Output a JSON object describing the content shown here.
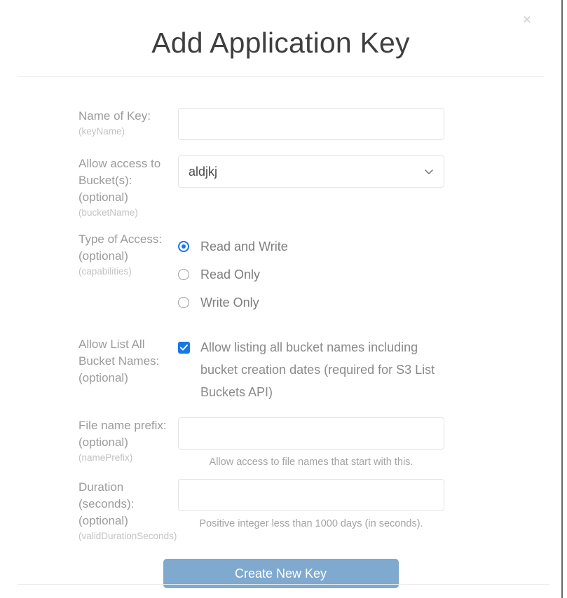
{
  "modal": {
    "title": "Add Application Key",
    "close_label": "×"
  },
  "fields": {
    "key_name": {
      "label": "Name of Key:",
      "api_name": "(keyName)",
      "value": "",
      "placeholder": ""
    },
    "bucket": {
      "label": "Allow access to Bucket(s):",
      "optional": "(optional)",
      "api_name": "(bucketName)",
      "value": "aldjkj",
      "chevron_icon": "chevron-down-icon"
    },
    "access_type": {
      "label": "Type of Access:",
      "optional": "(optional)",
      "api_name": "(capabilities)",
      "options": [
        {
          "label": "Read and Write",
          "selected": true
        },
        {
          "label": "Read Only",
          "selected": false
        },
        {
          "label": "Write Only",
          "selected": false
        }
      ]
    },
    "list_buckets": {
      "label": "Allow List All Bucket Names:",
      "optional": "(optional)",
      "checkbox_label": "Allow listing all bucket names including bucket creation dates (required for S3 List Buckets API)",
      "checked": true
    },
    "name_prefix": {
      "label": "File name prefix:",
      "optional": "(optional)",
      "api_name": "(namePrefix)",
      "value": "",
      "placeholder": "",
      "helper": "Allow access to file names that start with this."
    },
    "duration": {
      "label": "Duration (seconds):",
      "optional": "(optional)",
      "api_name": "(validDurationSeconds)",
      "value": "",
      "placeholder": "",
      "helper": "Positive integer less than 1000 days (in seconds)."
    }
  },
  "actions": {
    "submit_label": "Create New Key"
  },
  "colors": {
    "accent_blue": "#1877e8",
    "button_blue": "#7fa9ce",
    "label_gray": "#9b9b9b",
    "sub_label_gray": "#c2c2c2",
    "border_gray": "#e4e4e4"
  }
}
